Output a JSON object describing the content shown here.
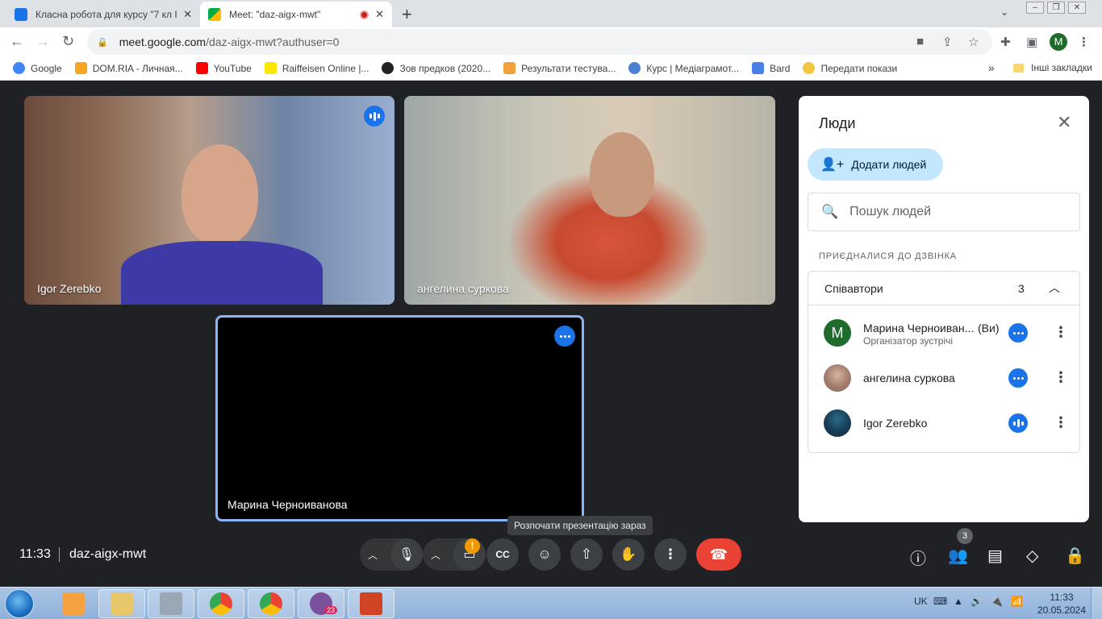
{
  "browser": {
    "tabs": [
      {
        "title": "Класна робота для курсу \"7 кл І",
        "active": false
      },
      {
        "title": "Meet: \"daz-aigx-mwt\"",
        "active": true
      }
    ],
    "url_host": "meet.google.com",
    "url_path": "/daz-aigx-mwt?authuser=0",
    "profile_initial": "M",
    "bookmarks": [
      {
        "label": "Google",
        "color": "#4285f4"
      },
      {
        "label": "DOM.RIA - Личная...",
        "color": "#f5a623"
      },
      {
        "label": "YouTube",
        "color": "#ff0000"
      },
      {
        "label": "Raiffeisen Online |...",
        "color": "#ffe600"
      },
      {
        "label": "Зов предков (2020...",
        "color": "#222222"
      },
      {
        "label": "Результати тестува...",
        "color": "#f2a23a"
      },
      {
        "label": "Курс | Медіаграмот...",
        "color": "#4a7fd4"
      },
      {
        "label": "Bard",
        "color": "#4b7fe8"
      },
      {
        "label": "Передати покази",
        "color": "#f4c542"
      }
    ],
    "other_bookmarks": "Інші закладки"
  },
  "tiles": {
    "igor": {
      "name": "Igor Zerebko"
    },
    "angelina": {
      "name": "ангелина суркова"
    },
    "marina": {
      "name": "Марина Черноиванова"
    }
  },
  "people_panel": {
    "title": "Люди",
    "add_button": "Додати людей",
    "search_placeholder": "Пошук людей",
    "joined_label": "ПРИЄДНАЛИСЯ ДО ДЗВІНКА",
    "group_label": "Співавтори",
    "group_count": "3",
    "participants": [
      {
        "name": "Марина Черноиван...",
        "you": "(Ви)",
        "role": "Організатор зустрічі",
        "initial": "M"
      },
      {
        "name": "ангелина суркова"
      },
      {
        "name": "Igor Zerebko"
      }
    ]
  },
  "bottom_bar": {
    "time": "11:33",
    "meeting_code": "daz-aigx-mwt",
    "tooltip": "Розпочати презентацію зараз",
    "people_count": "3"
  },
  "taskbar": {
    "lang": "UK",
    "time": "11:33",
    "date": "20.05.2024",
    "viber_badge": "23"
  }
}
